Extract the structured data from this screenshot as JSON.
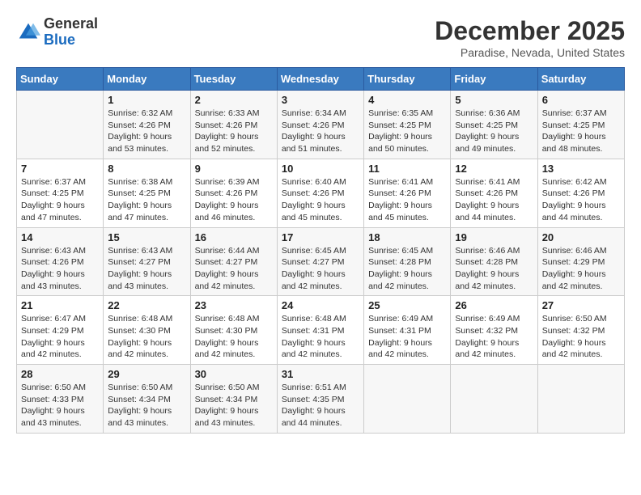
{
  "logo": {
    "general": "General",
    "blue": "Blue"
  },
  "title": "December 2025",
  "subtitle": "Paradise, Nevada, United States",
  "days_of_week": [
    "Sunday",
    "Monday",
    "Tuesday",
    "Wednesday",
    "Thursday",
    "Friday",
    "Saturday"
  ],
  "weeks": [
    [
      {
        "day": "",
        "sunrise": "",
        "sunset": "",
        "daylight": ""
      },
      {
        "day": "1",
        "sunrise": "Sunrise: 6:32 AM",
        "sunset": "Sunset: 4:26 PM",
        "daylight": "Daylight: 9 hours and 53 minutes."
      },
      {
        "day": "2",
        "sunrise": "Sunrise: 6:33 AM",
        "sunset": "Sunset: 4:26 PM",
        "daylight": "Daylight: 9 hours and 52 minutes."
      },
      {
        "day": "3",
        "sunrise": "Sunrise: 6:34 AM",
        "sunset": "Sunset: 4:26 PM",
        "daylight": "Daylight: 9 hours and 51 minutes."
      },
      {
        "day": "4",
        "sunrise": "Sunrise: 6:35 AM",
        "sunset": "Sunset: 4:25 PM",
        "daylight": "Daylight: 9 hours and 50 minutes."
      },
      {
        "day": "5",
        "sunrise": "Sunrise: 6:36 AM",
        "sunset": "Sunset: 4:25 PM",
        "daylight": "Daylight: 9 hours and 49 minutes."
      },
      {
        "day": "6",
        "sunrise": "Sunrise: 6:37 AM",
        "sunset": "Sunset: 4:25 PM",
        "daylight": "Daylight: 9 hours and 48 minutes."
      }
    ],
    [
      {
        "day": "7",
        "sunrise": "Sunrise: 6:37 AM",
        "sunset": "Sunset: 4:25 PM",
        "daylight": "Daylight: 9 hours and 47 minutes."
      },
      {
        "day": "8",
        "sunrise": "Sunrise: 6:38 AM",
        "sunset": "Sunset: 4:25 PM",
        "daylight": "Daylight: 9 hours and 47 minutes."
      },
      {
        "day": "9",
        "sunrise": "Sunrise: 6:39 AM",
        "sunset": "Sunset: 4:26 PM",
        "daylight": "Daylight: 9 hours and 46 minutes."
      },
      {
        "day": "10",
        "sunrise": "Sunrise: 6:40 AM",
        "sunset": "Sunset: 4:26 PM",
        "daylight": "Daylight: 9 hours and 45 minutes."
      },
      {
        "day": "11",
        "sunrise": "Sunrise: 6:41 AM",
        "sunset": "Sunset: 4:26 PM",
        "daylight": "Daylight: 9 hours and 45 minutes."
      },
      {
        "day": "12",
        "sunrise": "Sunrise: 6:41 AM",
        "sunset": "Sunset: 4:26 PM",
        "daylight": "Daylight: 9 hours and 44 minutes."
      },
      {
        "day": "13",
        "sunrise": "Sunrise: 6:42 AM",
        "sunset": "Sunset: 4:26 PM",
        "daylight": "Daylight: 9 hours and 44 minutes."
      }
    ],
    [
      {
        "day": "14",
        "sunrise": "Sunrise: 6:43 AM",
        "sunset": "Sunset: 4:26 PM",
        "daylight": "Daylight: 9 hours and 43 minutes."
      },
      {
        "day": "15",
        "sunrise": "Sunrise: 6:43 AM",
        "sunset": "Sunset: 4:27 PM",
        "daylight": "Daylight: 9 hours and 43 minutes."
      },
      {
        "day": "16",
        "sunrise": "Sunrise: 6:44 AM",
        "sunset": "Sunset: 4:27 PM",
        "daylight": "Daylight: 9 hours and 42 minutes."
      },
      {
        "day": "17",
        "sunrise": "Sunrise: 6:45 AM",
        "sunset": "Sunset: 4:27 PM",
        "daylight": "Daylight: 9 hours and 42 minutes."
      },
      {
        "day": "18",
        "sunrise": "Sunrise: 6:45 AM",
        "sunset": "Sunset: 4:28 PM",
        "daylight": "Daylight: 9 hours and 42 minutes."
      },
      {
        "day": "19",
        "sunrise": "Sunrise: 6:46 AM",
        "sunset": "Sunset: 4:28 PM",
        "daylight": "Daylight: 9 hours and 42 minutes."
      },
      {
        "day": "20",
        "sunrise": "Sunrise: 6:46 AM",
        "sunset": "Sunset: 4:29 PM",
        "daylight": "Daylight: 9 hours and 42 minutes."
      }
    ],
    [
      {
        "day": "21",
        "sunrise": "Sunrise: 6:47 AM",
        "sunset": "Sunset: 4:29 PM",
        "daylight": "Daylight: 9 hours and 42 minutes."
      },
      {
        "day": "22",
        "sunrise": "Sunrise: 6:48 AM",
        "sunset": "Sunset: 4:30 PM",
        "daylight": "Daylight: 9 hours and 42 minutes."
      },
      {
        "day": "23",
        "sunrise": "Sunrise: 6:48 AM",
        "sunset": "Sunset: 4:30 PM",
        "daylight": "Daylight: 9 hours and 42 minutes."
      },
      {
        "day": "24",
        "sunrise": "Sunrise: 6:48 AM",
        "sunset": "Sunset: 4:31 PM",
        "daylight": "Daylight: 9 hours and 42 minutes."
      },
      {
        "day": "25",
        "sunrise": "Sunrise: 6:49 AM",
        "sunset": "Sunset: 4:31 PM",
        "daylight": "Daylight: 9 hours and 42 minutes."
      },
      {
        "day": "26",
        "sunrise": "Sunrise: 6:49 AM",
        "sunset": "Sunset: 4:32 PM",
        "daylight": "Daylight: 9 hours and 42 minutes."
      },
      {
        "day": "27",
        "sunrise": "Sunrise: 6:50 AM",
        "sunset": "Sunset: 4:32 PM",
        "daylight": "Daylight: 9 hours and 42 minutes."
      }
    ],
    [
      {
        "day": "28",
        "sunrise": "Sunrise: 6:50 AM",
        "sunset": "Sunset: 4:33 PM",
        "daylight": "Daylight: 9 hours and 43 minutes."
      },
      {
        "day": "29",
        "sunrise": "Sunrise: 6:50 AM",
        "sunset": "Sunset: 4:34 PM",
        "daylight": "Daylight: 9 hours and 43 minutes."
      },
      {
        "day": "30",
        "sunrise": "Sunrise: 6:50 AM",
        "sunset": "Sunset: 4:34 PM",
        "daylight": "Daylight: 9 hours and 43 minutes."
      },
      {
        "day": "31",
        "sunrise": "Sunrise: 6:51 AM",
        "sunset": "Sunset: 4:35 PM",
        "daylight": "Daylight: 9 hours and 44 minutes."
      },
      {
        "day": "",
        "sunrise": "",
        "sunset": "",
        "daylight": ""
      },
      {
        "day": "",
        "sunrise": "",
        "sunset": "",
        "daylight": ""
      },
      {
        "day": "",
        "sunrise": "",
        "sunset": "",
        "daylight": ""
      }
    ]
  ]
}
